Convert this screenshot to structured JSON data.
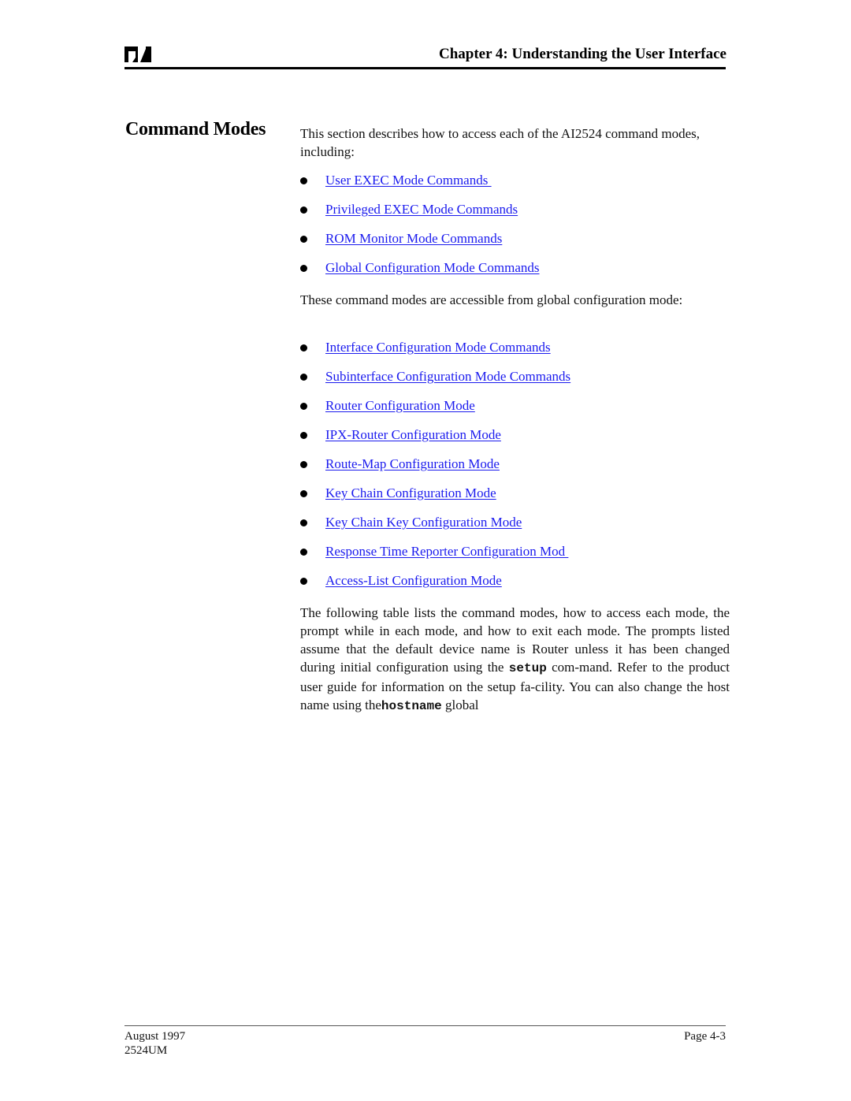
{
  "header": {
    "logo_icon": "ai-company-logo",
    "chapter_title": "Chapter 4: Understanding the User Interface"
  },
  "section": {
    "title": "Command Modes",
    "intro": "This section describes how to access each of the AI2524 command modes, including:",
    "primary_modes": [
      {
        "label": "User EXEC Mode Commands "
      },
      {
        "label": "Privileged EXEC Mode Commands"
      },
      {
        "label": "ROM Monitor Mode Commands"
      },
      {
        "label": "Global Configuration Mode Commands"
      }
    ],
    "secondary_intro": "These command modes are accessible from global configuration mode:",
    "global_config_modes": [
      {
        "label": "Interface Configuration Mode Commands"
      },
      {
        "label": "Subinterface Configuration Mode Commands"
      },
      {
        "label": "Router Configuration Mode"
      },
      {
        "label": "IPX-Router Configuration Mode"
      },
      {
        "label": "Route-Map Configuration Mode"
      },
      {
        "label": "Key Chain Configuration Mode"
      },
      {
        "label": "Key Chain Key Configuration Mode"
      },
      {
        "label": "Response Time Reporter Configuration Mod "
      },
      {
        "label": "Access-List Configuration Mode"
      }
    ],
    "table_intro": {
      "part1": "The following table lists the command modes, how to access each mode, the prompt while in each mode, and how to exit each mode. The prompts listed assume that the default device name is Router unless it has been changed during initial configuration using the ",
      "cmd_setup": "setup",
      "part2": " com-mand. Refer to the product user guide for information on the setup fa-cility. You can also change the host name using the",
      "cmd_hostname": "hostname",
      "part3": " global"
    }
  },
  "footer": {
    "date": "August 1997",
    "doc_id": "2524UM",
    "page": "Page 4-3"
  },
  "colors": {
    "link": "#1a1aee",
    "text": "#111111",
    "rule": "#000000"
  }
}
